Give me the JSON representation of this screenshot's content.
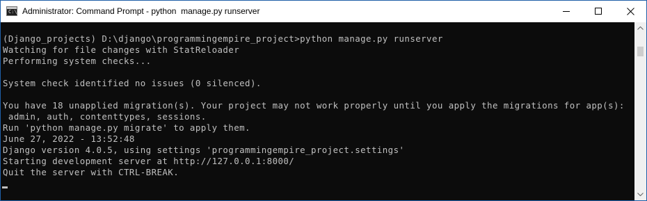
{
  "window": {
    "title": "Administrator: Command Prompt - python  manage.py runserver",
    "icon": "cmd-prompt-icon",
    "icon_glyph": "C:\\",
    "controls": [
      "minimize-icon",
      "maximize-icon",
      "close-icon"
    ]
  },
  "console": {
    "background": "#0c0c0c",
    "foreground": "#c0c0c0",
    "lines": [
      "(Django_projects) D:\\django\\programmingempire_project>python manage.py runserver",
      "Watching for file changes with StatReloader",
      "Performing system checks...",
      "",
      "System check identified no issues (0 silenced).",
      "",
      "You have 18 unapplied migration(s). Your project may not work properly until you apply the migrations for app(s):",
      " admin, auth, contenttypes, sessions.",
      "Run 'python manage.py migrate' to apply them.",
      "June 27, 2022 - 13:52:48",
      "Django version 4.0.5, using settings 'programmingempire_project.settings'",
      "Starting development server at http://127.0.0.1:8000/",
      "Quit the server with CTRL-BREAK.",
      ""
    ]
  },
  "scrollbar": {
    "up_icon": "chevron-up-icon",
    "down_icon": "chevron-down-icon",
    "position": 0
  }
}
